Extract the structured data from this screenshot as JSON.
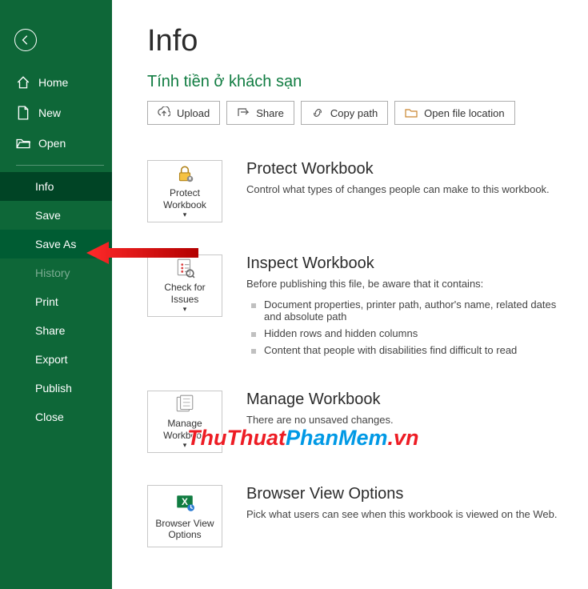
{
  "sidebar": {
    "top": [
      {
        "label": "Home",
        "icon": "home-icon"
      },
      {
        "label": "New",
        "icon": "new-icon"
      },
      {
        "label": "Open",
        "icon": "open-icon"
      }
    ],
    "bottom": [
      {
        "label": "Info",
        "state": "selected"
      },
      {
        "label": "Save"
      },
      {
        "label": "Save As",
        "state": "highlighted"
      },
      {
        "label": "History",
        "state": "dimmed"
      },
      {
        "label": "Print"
      },
      {
        "label": "Share"
      },
      {
        "label": "Export"
      },
      {
        "label": "Publish"
      },
      {
        "label": "Close"
      }
    ]
  },
  "page": {
    "title": "Info",
    "subtitle": "Tính tiền ở khách sạn"
  },
  "actions": {
    "upload": "Upload",
    "share": "Share",
    "copypath": "Copy path",
    "openloc": "Open file location"
  },
  "sections": {
    "protect": {
      "tile": "Protect Workbook",
      "title": "Protect Workbook",
      "desc": "Control what types of changes people can make to this workbook."
    },
    "inspect": {
      "tile": "Check for Issues",
      "title": "Inspect Workbook",
      "desc": "Before publishing this file, be aware that it contains:",
      "items": [
        "Document properties, printer path, author's name, related dates and absolute path",
        "Hidden rows and hidden columns",
        "Content that people with disabilities find difficult to read"
      ]
    },
    "manage": {
      "tile": "Manage Workbook",
      "title": "Manage Workbook",
      "desc": "There are no unsaved changes."
    },
    "browser": {
      "tile": "Browser View Options",
      "title": "Browser View Options",
      "desc": "Pick what users can see when this workbook is viewed on the Web."
    }
  },
  "watermark": {
    "part1": "ThuThuat",
    "part2": "PhanMem",
    "part3": ".vn"
  }
}
